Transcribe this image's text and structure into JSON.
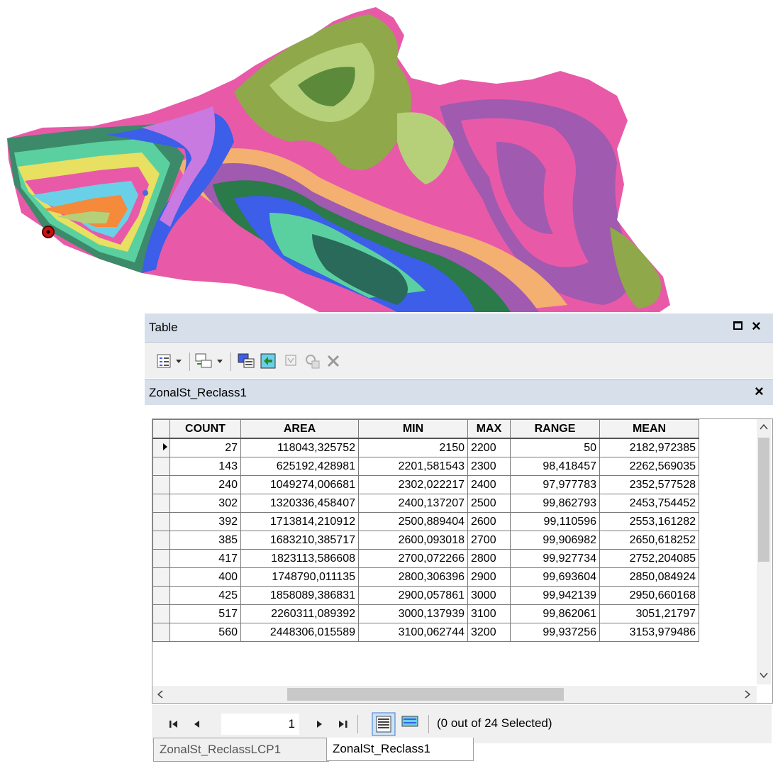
{
  "window": {
    "title": "Table",
    "table_name": "ZonalSt_Reclass1"
  },
  "toolbar": {
    "icons": [
      "table-options-icon",
      "related-tables-icon",
      "select-by-attributes-icon",
      "switch-selection-icon",
      "clear-selection-icon",
      "zoom-to-selected-icon",
      "delete-selected-icon"
    ]
  },
  "grid": {
    "columns": [
      "COUNT",
      "AREA",
      "MIN",
      "MAX",
      "RANGE",
      "MEAN"
    ],
    "rows": [
      [
        "27",
        "118043,325752",
        "2150",
        "2200",
        "50",
        "2182,972385"
      ],
      [
        "143",
        "625192,428981",
        "2201,581543",
        "2300",
        "98,418457",
        "2262,569035"
      ],
      [
        "240",
        "1049274,006681",
        "2302,022217",
        "2400",
        "97,977783",
        "2352,577528"
      ],
      [
        "302",
        "1320336,458407",
        "2400,137207",
        "2500",
        "99,862793",
        "2453,754452"
      ],
      [
        "392",
        "1713814,210912",
        "2500,889404",
        "2600",
        "99,110596",
        "2553,161282"
      ],
      [
        "385",
        "1683210,385717",
        "2600,093018",
        "2700",
        "99,906982",
        "2650,618252"
      ],
      [
        "417",
        "1823113,586608",
        "2700,072266",
        "2800",
        "99,927734",
        "2752,204085"
      ],
      [
        "400",
        "1748790,011135",
        "2800,306396",
        "2900",
        "99,693604",
        "2850,084924"
      ],
      [
        "425",
        "1858089,386831",
        "2900,057861",
        "3000",
        "99,942139",
        "2950,660168"
      ],
      [
        "517",
        "2260311,089392",
        "3000,137939",
        "3100",
        "99,862061",
        "3051,21797"
      ],
      [
        "560",
        "2448306,015589",
        "3100,062744",
        "3200",
        "99,937256",
        "3153,979486"
      ]
    ]
  },
  "navigation": {
    "record_number": "1",
    "selection_status": "(0 out of 24 Selected)"
  },
  "tabs": [
    "ZonalSt_ReclassLCP1",
    "ZonalSt_Reclass1"
  ],
  "colors": {
    "titlebar": "#d6dfea",
    "map_pink": "#e85aa8",
    "map_olive": "#8fa84a",
    "map_purple": "#a05ab0",
    "map_blue": "#3c5ee8",
    "map_green": "#2a7a4a"
  }
}
